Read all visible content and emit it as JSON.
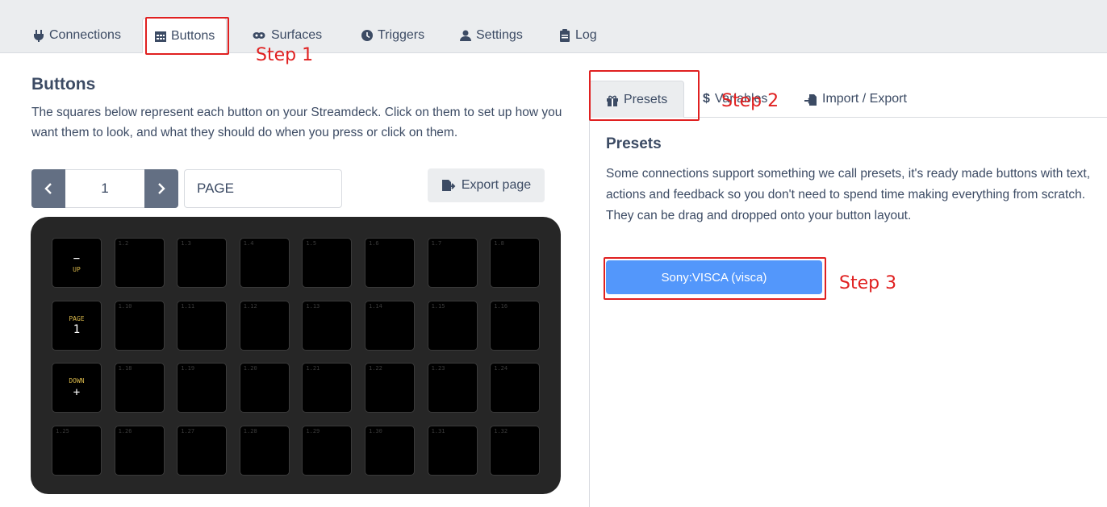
{
  "nav": {
    "tabs": [
      {
        "label": "Connections",
        "icon": "plug-icon"
      },
      {
        "label": "Buttons",
        "icon": "calendar-grid-icon"
      },
      {
        "label": "Surfaces",
        "icon": "gamepad-icon"
      },
      {
        "label": "Triggers",
        "icon": "clock-icon"
      },
      {
        "label": "Settings",
        "icon": "user-cog-icon"
      },
      {
        "label": "Log",
        "icon": "clipboard-icon"
      }
    ],
    "active": "Buttons"
  },
  "annotations": {
    "step1": "Step 1",
    "step2": "Step 2",
    "step3": "Step 3",
    "color": "#e02020"
  },
  "buttons_panel": {
    "title": "Buttons",
    "description": "The squares below represent each button on your Streamdeck. Click on them to set up how you want them to look, and what they should do when you press or click on them.",
    "page_number": "1",
    "page_name": "PAGE",
    "export_label": "Export page"
  },
  "deck": {
    "keys": [
      {
        "id": "1.1",
        "line1": "−",
        "line2": "UP",
        "style": "up"
      },
      {
        "id": "1.2"
      },
      {
        "id": "1.3"
      },
      {
        "id": "1.4"
      },
      {
        "id": "1.5"
      },
      {
        "id": "1.6"
      },
      {
        "id": "1.7"
      },
      {
        "id": "1.8"
      },
      {
        "id": "1.9",
        "line1": "PAGE",
        "line2": "1",
        "style": "page"
      },
      {
        "id": "1.10"
      },
      {
        "id": "1.11"
      },
      {
        "id": "1.12"
      },
      {
        "id": "1.13"
      },
      {
        "id": "1.14"
      },
      {
        "id": "1.15"
      },
      {
        "id": "1.16"
      },
      {
        "id": "1.17",
        "line1": "DOWN",
        "line2": "+",
        "style": "down"
      },
      {
        "id": "1.18"
      },
      {
        "id": "1.19"
      },
      {
        "id": "1.20"
      },
      {
        "id": "1.21"
      },
      {
        "id": "1.22"
      },
      {
        "id": "1.23"
      },
      {
        "id": "1.24"
      },
      {
        "id": "1.25"
      },
      {
        "id": "1.26"
      },
      {
        "id": "1.27"
      },
      {
        "id": "1.28"
      },
      {
        "id": "1.29"
      },
      {
        "id": "1.30"
      },
      {
        "id": "1.31"
      },
      {
        "id": "1.32"
      }
    ]
  },
  "right_panel": {
    "tabs": [
      {
        "label": "Presets",
        "icon": "gift-icon"
      },
      {
        "label": "Variables",
        "icon": "dollar-icon"
      },
      {
        "label": "Import / Export",
        "icon": "file-import-icon"
      }
    ],
    "active": "Presets",
    "presets_title": "Presets",
    "presets_description": "Some connections support something we call presets, it's ready made buttons with text, actions and feedback so you don't need to spend time making everything from scratch. They can be drag and dropped onto your button layout.",
    "preset_button": "Sony:VISCA (visca)"
  }
}
